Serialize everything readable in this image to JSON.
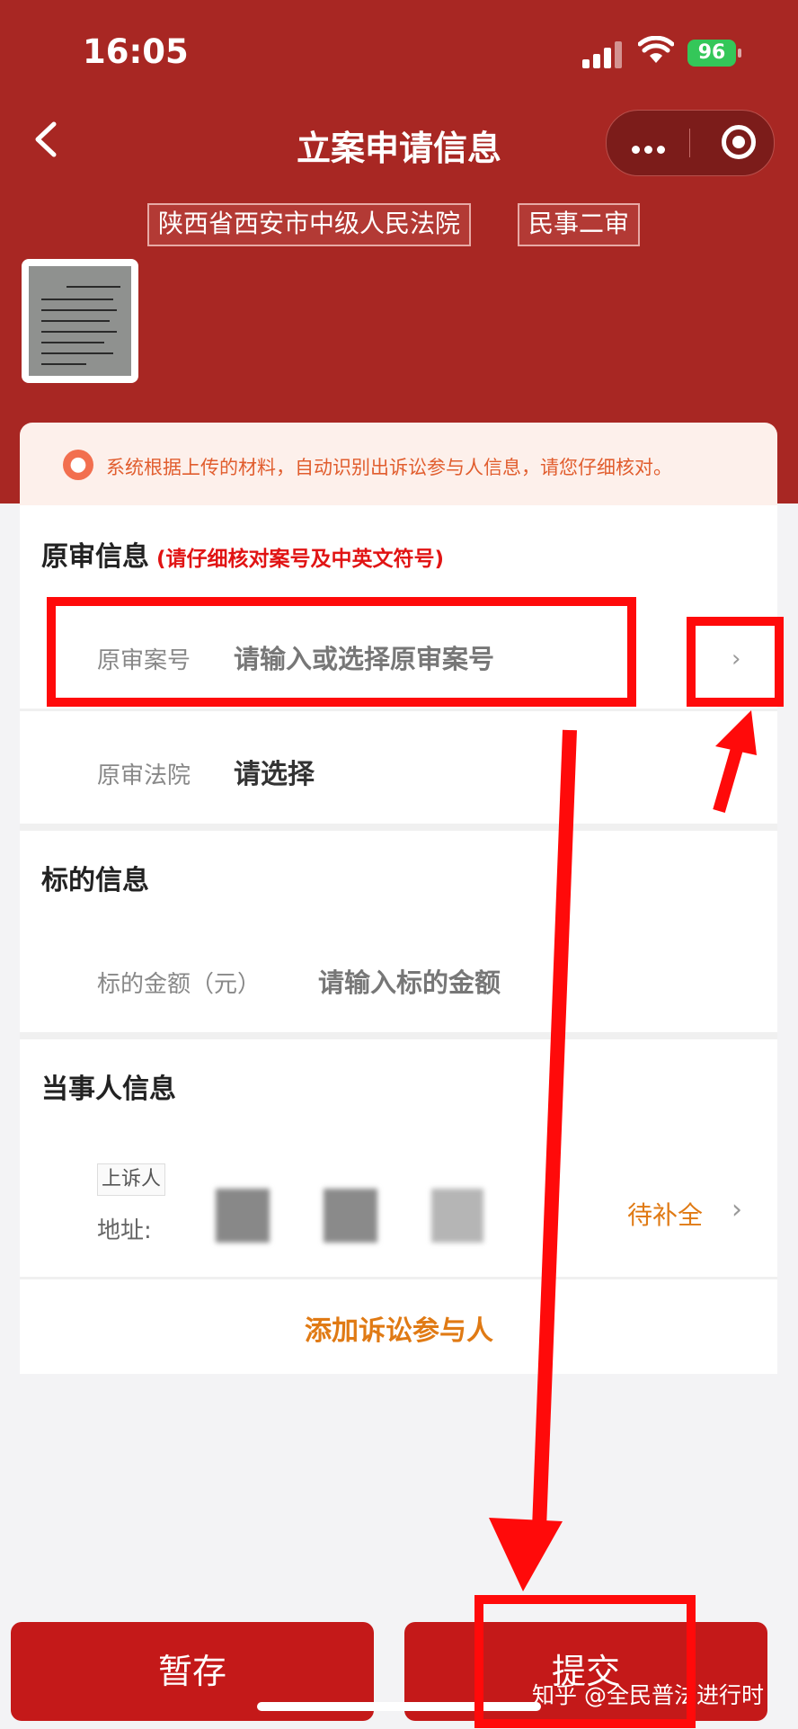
{
  "status_bar": {
    "time": "16:05",
    "battery": "96"
  },
  "nav": {
    "title": "立案申请信息"
  },
  "tags": {
    "court": "陕西省西安市中级人民法院",
    "case_type": "民事二审"
  },
  "notice": {
    "text": "系统根据上传的材料，自动识别出诉讼参与人信息，请您仔细核对。"
  },
  "original_trial": {
    "title": "原审信息",
    "note": "(请仔细核对案号及中英文符号)",
    "case_no_label": "原审案号",
    "case_no_placeholder": "请输入或选择原审案号",
    "court_label": "原审法院",
    "court_value": "请选择"
  },
  "subject": {
    "title": "标的信息",
    "amount_label": "标的金额（元）",
    "amount_placeholder": "请输入标的金额"
  },
  "parties": {
    "title": "当事人信息",
    "role_badge": "上诉人",
    "address_label": "地址:",
    "status": "待补全"
  },
  "add_party": "添加诉讼参与人",
  "buttons": {
    "save": "暂存",
    "submit": "提交"
  },
  "watermark": "知乎 @全民普法进行时",
  "colors": {
    "header": "#a82723",
    "button": "#c41919",
    "accent_orange": "#e07a14",
    "annotation_red": "#ff0a0a"
  }
}
